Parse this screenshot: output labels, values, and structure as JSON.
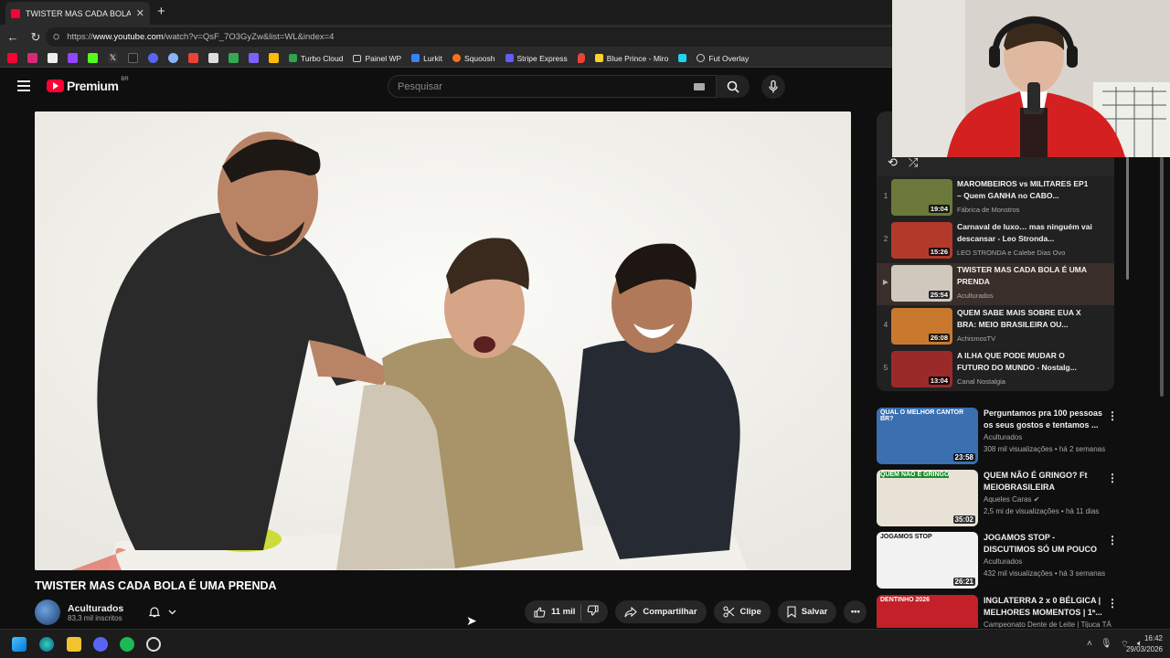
{
  "browser": {
    "tab_title": "TWISTER MAS CADA BOLA É UMA PRENDA",
    "url_prefix": "https://",
    "url_host": "www.youtube.com",
    "url_path": "/watch?v=QsF_7O3GyZw&list=WL&index=4",
    "bookmarks": [
      "Turbo Cloud",
      "Painel WP",
      "Lurkit",
      "Squoosh",
      "Stripe Express",
      "Blue Prince - Miro",
      "Fut Overlay"
    ]
  },
  "youtube": {
    "logo_text": "Premium",
    "region": "BR",
    "search_placeholder": "Pesquisar"
  },
  "video": {
    "title": "TWISTER MAS CADA BOLA É UMA PRENDA",
    "channel": "Aculturados",
    "subscribers": "83,3 mil inscritos",
    "likes": "11 mil",
    "share_label": "Compartilhar",
    "clip_label": "Clipe",
    "save_label": "Salvar"
  },
  "playlist": {
    "items": [
      {
        "index": "1",
        "title": "MAROMBEIROS vs MILITARES EP1 – Quem GANHA no CABO...",
        "channel": "Fábrica de Monstros",
        "duration": "19:04",
        "color": "#6b7a3a"
      },
      {
        "index": "2",
        "title": "Carnaval de luxo… mas ninguém vai descansar - Leo Stronda...",
        "channel": "LEO STRONDA e Calebe Dias Ovo",
        "duration": "15:26",
        "color": "#b23a2a"
      },
      {
        "index": "▶",
        "title": "TWISTER MAS CADA BOLA É UMA PRENDA",
        "channel": "Aculturados",
        "duration": "25:54",
        "color": "#cfc8bd"
      },
      {
        "index": "4",
        "title": "QUEM SABE MAIS SOBRE EUA X BRA: MEIO BRASILEIRA OU...",
        "channel": "AchismosTV",
        "duration": "26:08",
        "color": "#c9792e"
      },
      {
        "index": "5",
        "title": "A ILHA QUE PODE MUDAR O FUTURO DO MUNDO - Nostalg...",
        "channel": "Canal Nostalgia",
        "duration": "13:04",
        "color": "#9a2a2a"
      }
    ]
  },
  "recommendations": [
    {
      "title": "Perguntamos pra 100 pessoas os seus gostos e tentamos ...",
      "channel": "Aculturados",
      "meta": "308 mil visualizações • há 2 semanas",
      "duration": "23:58",
      "label": "QUAL O MELHOR CANTOR BR?",
      "color": "#3b6fb0"
    },
    {
      "title": "QUEM NÃO É GRINGO? Ft MEIOBRASILEIRA",
      "channel": "Aqueles Caras ✔",
      "meta": "2,5 mi de visualizações • há 11 dias",
      "duration": "35:02",
      "label": "QUEM NÃO É GRINGO",
      "color": "#e8e2d6"
    },
    {
      "title": "JOGAMOS STOP - DISCUTIMOS SÓ UM POUCO",
      "channel": "Aculturados",
      "meta": "432 mil visualizações • há 3 semanas",
      "duration": "26:21",
      "label": "JOGAMOS STOP",
      "color": "#f2f2f2"
    },
    {
      "title": "INGLATERRA 2 x 0 BÉLGICA | MELHORES MOMENTOS | 1ª...",
      "channel": "Campeonato Dente de Leite | Tijuca TÁ",
      "meta": "",
      "duration": "",
      "label": "DENTINHO 2026",
      "color": "#c4202a"
    }
  ],
  "taskbar": {
    "time": "16:42",
    "date": "29/03/2026"
  }
}
